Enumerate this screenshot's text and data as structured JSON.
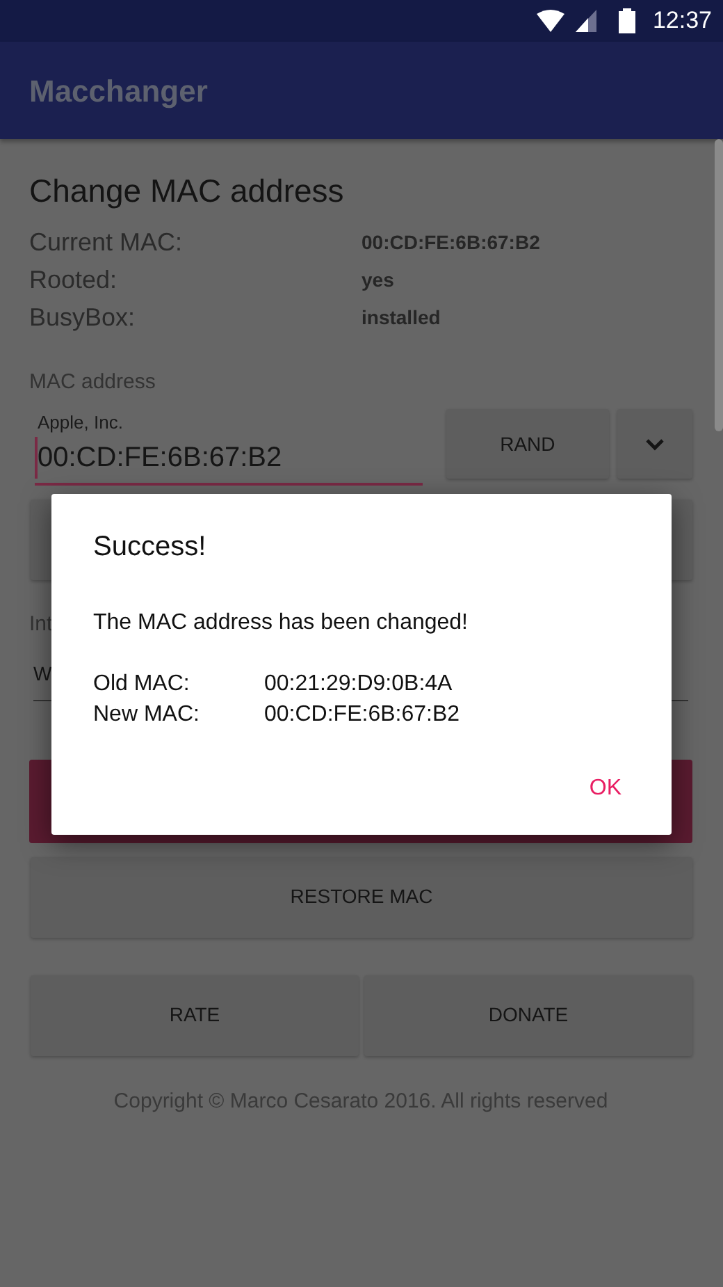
{
  "status_bar": {
    "time": "12:37"
  },
  "app_bar": {
    "title": "Macchanger"
  },
  "section_title": "Change MAC address",
  "info": [
    {
      "label": "Current MAC:",
      "value": "00:CD:FE:6B:67:B2"
    },
    {
      "label": "Rooted:",
      "value": "yes"
    },
    {
      "label": "BusyBox:",
      "value": "installed"
    }
  ],
  "mac_field": {
    "section_label": "MAC address",
    "label": "Apple, Inc.",
    "value": "00:CD:FE:6B:67:B2",
    "focused": true
  },
  "rand_button": "RAND",
  "interface": {
    "label": "Int",
    "value": "W"
  },
  "restore_button": "RESTORE MAC",
  "bottom_buttons": [
    "RATE",
    "DONATE"
  ],
  "copyright": "Copyright © Marco Cesarato 2016. All rights reserved",
  "dialog": {
    "title": "Success!",
    "message": "The MAC address has been changed!",
    "rows": [
      {
        "label": "Old MAC:",
        "value": "00:21:29:D9:0B:4A"
      },
      {
        "label": "New MAC:",
        "value": "00:CD:FE:6B:67:B2"
      }
    ],
    "button": "OK"
  }
}
